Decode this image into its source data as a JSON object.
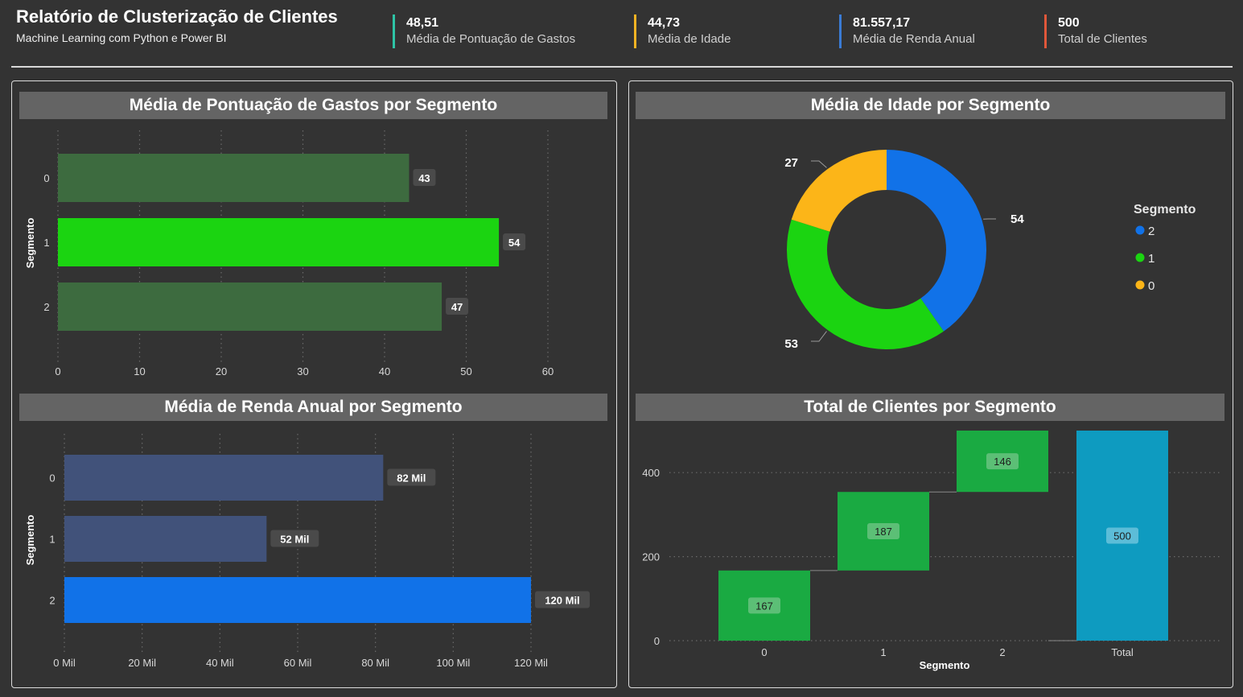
{
  "header": {
    "title": "Relatório de Clusterização de Clientes",
    "subtitle": "Machine Learning com Python e Power BI"
  },
  "kpis": [
    {
      "value": "48,51",
      "label": "Média de Pontuação de Gastos",
      "color": "#2ec4a6"
    },
    {
      "value": "44,73",
      "label": "Média de Idade",
      "color": "#f5b323"
    },
    {
      "value": "81.557,17",
      "label": "Média de Renda Anual",
      "color": "#3a7bd5"
    },
    {
      "value": "500",
      "label": "Total de Clientes",
      "color": "#e0573a"
    }
  ],
  "chart_data": [
    {
      "type": "bar",
      "orientation": "horizontal",
      "title": "Média de Pontuação de Gastos por Segmento",
      "ylabel": "Segmento",
      "categories": [
        "0",
        "1",
        "2"
      ],
      "values": [
        43,
        54,
        47
      ],
      "data_labels": [
        "43",
        "54",
        "47"
      ],
      "xlim": [
        0,
        60
      ],
      "xticks": [
        0,
        10,
        20,
        30,
        40,
        50,
        60
      ],
      "xtick_labels": [
        "0",
        "10",
        "20",
        "30",
        "40",
        "50",
        "60"
      ],
      "colors": [
        "#3d6b3f",
        "#1bd411",
        "#3d6b3f"
      ]
    },
    {
      "type": "pie",
      "donut": true,
      "title": "Média de Idade por Segmento",
      "legend_title": "Segmento",
      "legend_position": "right",
      "slices": [
        {
          "label": "2",
          "value": 54,
          "color": "#1172e8"
        },
        {
          "label": "1",
          "value": 53,
          "color": "#1bd411"
        },
        {
          "label": "0",
          "value": 27,
          "color": "#fcb518"
        }
      ]
    },
    {
      "type": "bar",
      "orientation": "horizontal",
      "title": "Média de Renda Anual por Segmento",
      "ylabel": "Segmento",
      "categories": [
        "0",
        "1",
        "2"
      ],
      "values": [
        82000,
        52000,
        120000
      ],
      "data_labels": [
        "82 Mil",
        "52 Mil",
        "120 Mil"
      ],
      "xlim": [
        0,
        120000
      ],
      "xticks": [
        0,
        20000,
        40000,
        60000,
        80000,
        100000,
        120000
      ],
      "xtick_labels": [
        "0 Mil",
        "20 Mil",
        "40 Mil",
        "60 Mil",
        "80 Mil",
        "100 Mil",
        "120 Mil"
      ],
      "colors": [
        "#41527a",
        "#41527a",
        "#1172e8"
      ]
    },
    {
      "type": "bar",
      "subtype": "waterfall",
      "title": "Total de Clientes por Segmento",
      "xlabel": "Segmento",
      "categories": [
        "0",
        "1",
        "2",
        "Total"
      ],
      "values": [
        167,
        187,
        146,
        500
      ],
      "data_labels": [
        "167",
        "187",
        "146",
        "500"
      ],
      "ylim": [
        0,
        500
      ],
      "yticks": [
        0,
        200,
        400
      ],
      "ytick_labels": [
        "0",
        "200",
        "400"
      ],
      "colors": {
        "increase": "#1aaa42",
        "total": "#0e9bc0"
      }
    }
  ]
}
